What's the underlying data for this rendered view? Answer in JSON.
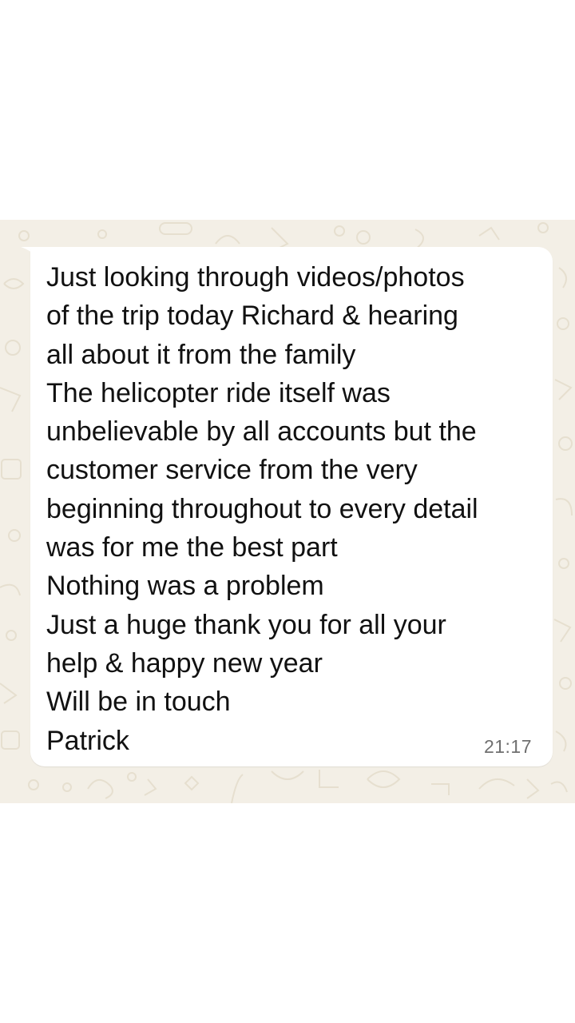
{
  "chat": {
    "message": {
      "lines": [
        "Just looking through videos/photos",
        "of the trip today Richard & hearing",
        "all about it from the family",
        "The helicopter ride itself was",
        "unbelievable by all accounts but the",
        "customer service from the very",
        "beginning throughout to every detail",
        "was for me the best part",
        "Nothing was a problem",
        "Just a huge thank you for all your",
        "help & happy new year",
        "Will be in touch",
        "Patrick"
      ],
      "time": "21:17"
    },
    "colors": {
      "wallpaper": "#f3efe6",
      "bubble": "#ffffff",
      "text": "#111111",
      "time": "#6f6f6f"
    }
  }
}
